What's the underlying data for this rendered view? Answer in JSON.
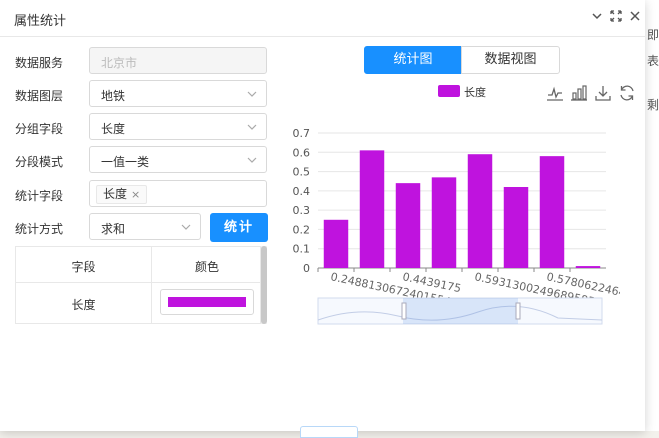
{
  "window": {
    "title": "属性统计"
  },
  "form": {
    "service_label": "数据服务",
    "service_value": "北京市",
    "layer_label": "数据图层",
    "layer_value": "地铁",
    "group_label": "分组字段",
    "group_value": "长度",
    "mode_label": "分段模式",
    "mode_value": "一值一类",
    "stat_field_label": "统计字段",
    "stat_field_tag": "长度",
    "method_label": "统计方式",
    "method_value": "求和",
    "stat_button": "统计"
  },
  "table": {
    "headers": [
      "字段",
      "颜色"
    ],
    "rows": [
      {
        "field": "长度",
        "color": "#bf13de"
      }
    ]
  },
  "tabs": [
    {
      "label": "统计图",
      "active": true
    },
    {
      "label": "数据视图",
      "active": false
    }
  ],
  "toolbar_icons": [
    "line-chart-icon",
    "bar-chart-icon",
    "download-icon",
    "refresh-icon"
  ],
  "colors": {
    "accent": "#1890ff",
    "series": "#bf13de"
  },
  "right_strip": [
    "即",
    "剩",
    "表"
  ],
  "chart_data": {
    "type": "bar",
    "legend": [
      "长度"
    ],
    "series": [
      {
        "name": "长度",
        "values": [
          0.25,
          0.61,
          0.44,
          0.47,
          0.59,
          0.42,
          0.58,
          0.01
        ]
      }
    ],
    "x_tick_labels": [
      "0.2488130672401554",
      "0.4439175",
      "0.5931300249689585",
      "0.5780622464137"
    ],
    "ylim": [
      0,
      0.7
    ],
    "yticks": [
      "0",
      "0.1",
      "0.2",
      "0.3",
      "0.4",
      "0.5",
      "0.6",
      "0.7"
    ],
    "grid": true,
    "legend_position": "top-center",
    "data_zoom": true
  }
}
